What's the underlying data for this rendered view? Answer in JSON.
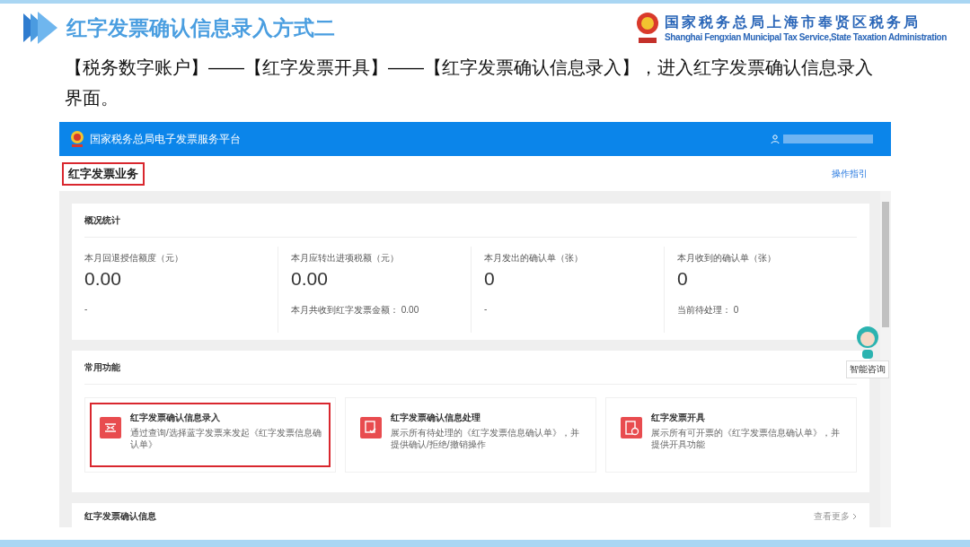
{
  "slide": {
    "title": "红字发票确认信息录入方式二",
    "org_name": "国家税务总局上海市奉贤区税务局",
    "org_name_en": "Shanghai Fengxian Municipal Tax Service,State Taxation Administration",
    "instruction": "【税务数字账户】——【红字发票开具】——【红字发票确认信息录入】，进入红字发票确认信息录入界面。"
  },
  "app": {
    "platform_title": "国家税务总局电子发票服务平台",
    "page_heading": {
      "text": "红字发票业务",
      "highlighted": true
    },
    "guide_link": "操作指引",
    "overview": {
      "title": "概况统计",
      "stats": [
        {
          "label": "本月回退授信额度（元）",
          "value": "0.00",
          "footer": "-"
        },
        {
          "label": "本月应转出进项税额（元）",
          "value": "0.00",
          "footer": "本月共收到红字发票金额：  0.00"
        },
        {
          "label": "本月发出的确认单（张）",
          "value": "0",
          "footer": "-"
        },
        {
          "label": "本月收到的确认单（张）",
          "value": "0",
          "footer": "当前待处理：  0"
        }
      ]
    },
    "functions": {
      "title": "常用功能",
      "items": [
        {
          "kind": "entry",
          "title": "红字发票确认信息录入",
          "desc": "通过查询/选择蓝字发票来发起《红字发票信息确认单》",
          "highlighted": true
        },
        {
          "kind": "process",
          "title": "红字发票确认信息处理",
          "desc": "展示所有待处理的《红字发票信息确认单》，并提供确认/拒绝/撤销操作",
          "highlighted": false
        },
        {
          "kind": "issue",
          "title": "红字发票开具",
          "desc": "展示所有可开票的《红字发票信息确认单》，并提供开具功能",
          "highlighted": false
        }
      ]
    },
    "confirm_section": {
      "title": "红字发票确认信息",
      "more_link": "查看更多"
    },
    "assistant_label": "智能咨询"
  }
}
